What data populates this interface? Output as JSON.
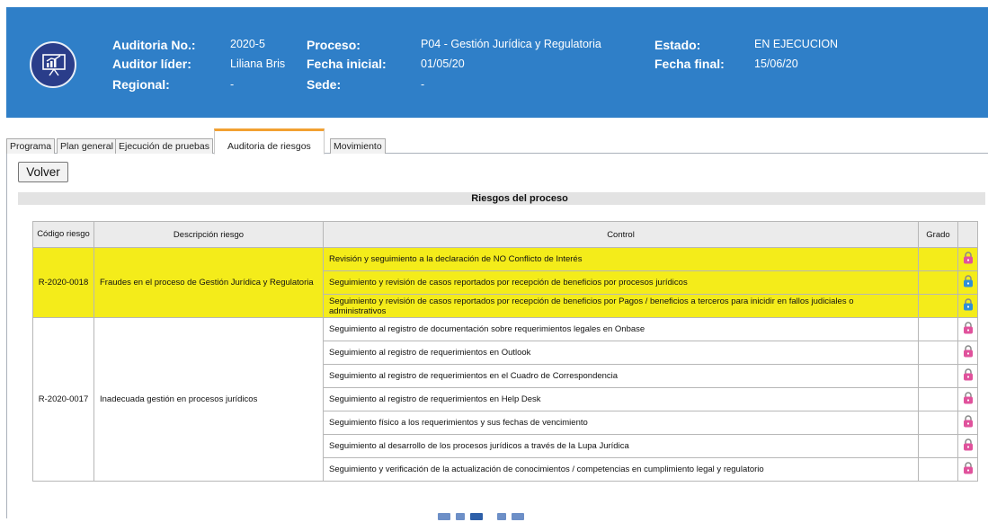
{
  "header": {
    "auditoria_label": "Auditoria No.:",
    "auditoria_value": "2020-5",
    "auditor_label": "Auditor líder:",
    "auditor_value": "Liliana Bris",
    "regional_label": "Regional:",
    "regional_value": "-",
    "proceso_label": "Proceso:",
    "proceso_value": "P04 - Gestión Jurídica y Regulatoria",
    "fecha_inicial_label": "Fecha inicial:",
    "fecha_inicial_value": "01/05/20",
    "sede_label": "Sede:",
    "sede_value": "-",
    "estado_label": "Estado:",
    "estado_value": "EN EJECUCION",
    "fecha_final_label": "Fecha final:",
    "fecha_final_value": "15/06/20"
  },
  "tabs": [
    "Programa",
    "Plan general",
    "Ejecución de pruebas",
    "Auditoria de riesgos",
    "Movimiento"
  ],
  "active_tab": "Auditoria de riesgos",
  "back_button": "Volver",
  "section_title": "Riesgos del proceso",
  "table": {
    "headers": [
      "Código riesgo",
      "Descripción riesgo",
      "Control",
      "Grado"
    ],
    "risks": [
      {
        "code": "R-2020-0018",
        "description": "Fraudes en el proceso de Gestión Jurídica y Regulatoria",
        "highlight": "#f4ec1a",
        "controls": [
          {
            "text": "Revisión y seguimiento a la declaración de NO Conflicto de Interés",
            "grado": "",
            "icon": "pink-lock-icon"
          },
          {
            "text": "Seguimiento y revisión de casos reportados por recepción de beneficios por procesos jurídicos",
            "grado": "",
            "icon": "blue-lock-icon"
          },
          {
            "text": "Seguimiento y revisión de casos reportados por recepción de beneficios por Pagos / beneficios a terceros para inicidir en fallos judiciales o administrativos",
            "grado": "",
            "icon": "blue-lock-icon"
          }
        ]
      },
      {
        "code": "R-2020-0017",
        "description": "Inadecuada gestión en procesos jurídicos",
        "highlight": "#ffffff",
        "controls": [
          {
            "text": "Seguimiento al registro de documentación sobre requerimientos legales en Onbase",
            "grado": "",
            "icon": "pink-lock-icon"
          },
          {
            "text": "Seguimiento al registro de requerimientos en Outlook",
            "grado": "",
            "icon": "pink-lock-icon"
          },
          {
            "text": "Seguimiento al registro de requerimientos en el Cuadro de Correspondencia",
            "grado": "",
            "icon": "pink-lock-icon"
          },
          {
            "text": "Seguimiento al registro de requerimientos en Help Desk",
            "grado": "",
            "icon": "pink-lock-icon"
          },
          {
            "text": "Seguimiento físico a los requerimientos y sus fechas de vencimiento",
            "grado": "",
            "icon": "pink-lock-icon"
          },
          {
            "text": "Seguimiento al desarrollo de los procesos jurídicos a través de la Lupa Jurídica",
            "grado": "",
            "icon": "pink-lock-icon"
          },
          {
            "text": "Seguimiento y verificación de la actualización de conocimientos / competencias en cumplimiento legal y regulatorio",
            "grado": "",
            "icon": "pink-lock-icon"
          }
        ]
      }
    ]
  },
  "colors": {
    "header_bg": "#2f7fc8",
    "highlight_row": "#f4ec1a",
    "pink_lock": "#e0529c",
    "blue_lock": "#2f8fd8",
    "active_tab_accent": "#f2a132"
  }
}
